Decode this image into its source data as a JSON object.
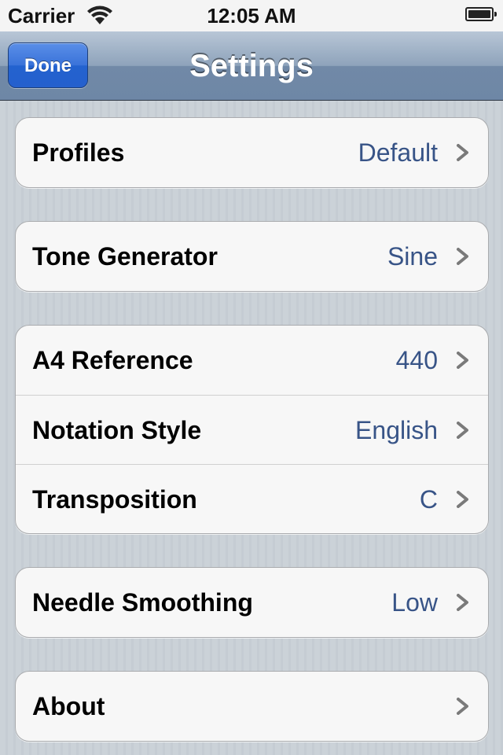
{
  "status_bar": {
    "carrier": "Carrier",
    "time": "12:05 AM",
    "wifi_icon": "wifi-icon",
    "battery_icon": "battery-icon"
  },
  "nav_bar": {
    "title": "Settings",
    "done_label": "Done"
  },
  "colors": {
    "value_text": "#385487",
    "done_button": "#2a66d3",
    "nav_bar": "#7f96b3"
  },
  "groups": [
    {
      "rows": [
        {
          "label": "Profiles",
          "value": "Default"
        }
      ]
    },
    {
      "rows": [
        {
          "label": "Tone Generator",
          "value": "Sine"
        }
      ]
    },
    {
      "rows": [
        {
          "label": "A4 Reference",
          "value": "440"
        },
        {
          "label": "Notation Style",
          "value": "English"
        },
        {
          "label": "Transposition",
          "value": "C"
        }
      ]
    },
    {
      "rows": [
        {
          "label": "Needle Smoothing",
          "value": "Low"
        }
      ]
    },
    {
      "rows": [
        {
          "label": "About",
          "value": ""
        }
      ]
    }
  ]
}
